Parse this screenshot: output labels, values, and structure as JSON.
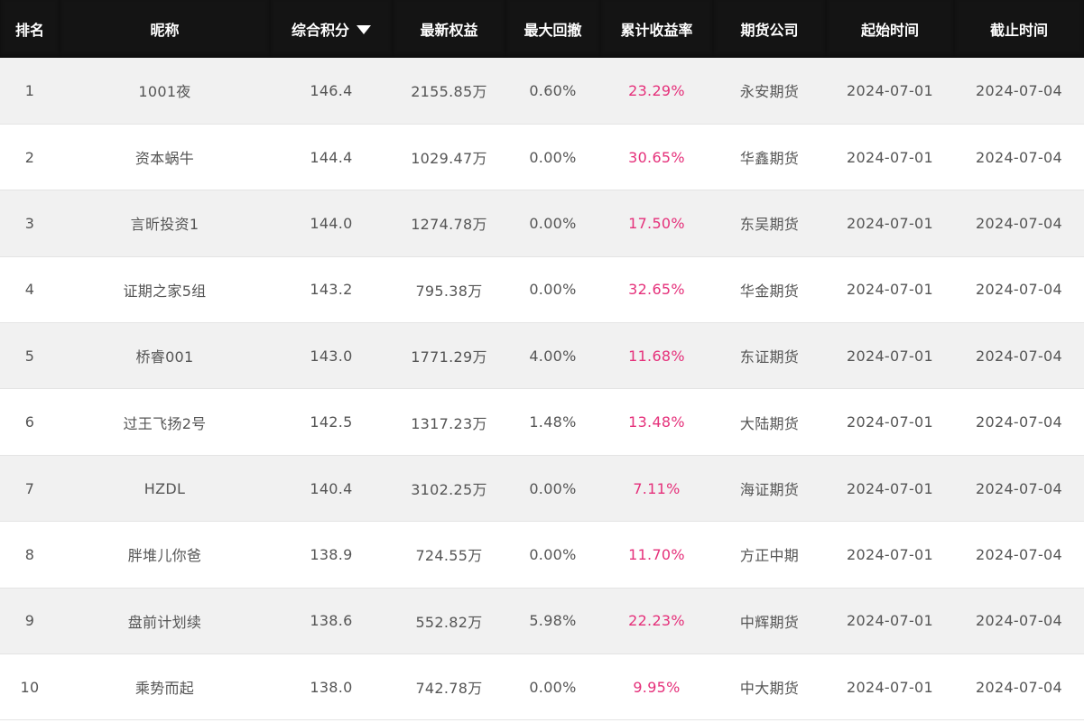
{
  "colors": {
    "header_bg": "#141414",
    "return_color": "#e5307a",
    "row_alt": "#f1f1f1"
  },
  "header": {
    "rank": "排名",
    "nickname": "昵称",
    "score": "综合积分",
    "equity": "最新权益",
    "drawdown": "最大回撤",
    "return": "累计收益率",
    "broker": "期货公司",
    "start": "起始时间",
    "end": "截止时间",
    "sort_icon": "triangle-down-icon"
  },
  "rows": [
    {
      "rank": "1",
      "nickname": "1001夜",
      "score": "146.4",
      "equity": "2155.85万",
      "drawdown": "0.60%",
      "return": "23.29%",
      "broker": "永安期货",
      "start": "2024-07-01",
      "end": "2024-07-04"
    },
    {
      "rank": "2",
      "nickname": "资本蜗牛",
      "score": "144.4",
      "equity": "1029.47万",
      "drawdown": "0.00%",
      "return": "30.65%",
      "broker": "华鑫期货",
      "start": "2024-07-01",
      "end": "2024-07-04"
    },
    {
      "rank": "3",
      "nickname": "言昕投资1",
      "score": "144.0",
      "equity": "1274.78万",
      "drawdown": "0.00%",
      "return": "17.50%",
      "broker": "东吴期货",
      "start": "2024-07-01",
      "end": "2024-07-04"
    },
    {
      "rank": "4",
      "nickname": "证期之家5组",
      "score": "143.2",
      "equity": "795.38万",
      "drawdown": "0.00%",
      "return": "32.65%",
      "broker": "华金期货",
      "start": "2024-07-01",
      "end": "2024-07-04"
    },
    {
      "rank": "5",
      "nickname": "桥睿001",
      "score": "143.0",
      "equity": "1771.29万",
      "drawdown": "4.00%",
      "return": "11.68%",
      "broker": "东证期货",
      "start": "2024-07-01",
      "end": "2024-07-04"
    },
    {
      "rank": "6",
      "nickname": "过王飞扬2号",
      "score": "142.5",
      "equity": "1317.23万",
      "drawdown": "1.48%",
      "return": "13.48%",
      "broker": "大陆期货",
      "start": "2024-07-01",
      "end": "2024-07-04"
    },
    {
      "rank": "7",
      "nickname": "HZDL",
      "score": "140.4",
      "equity": "3102.25万",
      "drawdown": "0.00%",
      "return": "7.11%",
      "broker": "海证期货",
      "start": "2024-07-01",
      "end": "2024-07-04"
    },
    {
      "rank": "8",
      "nickname": "胖堆儿你爸",
      "score": "138.9",
      "equity": "724.55万",
      "drawdown": "0.00%",
      "return": "11.70%",
      "broker": "方正中期",
      "start": "2024-07-01",
      "end": "2024-07-04"
    },
    {
      "rank": "9",
      "nickname": "盘前计划续",
      "score": "138.6",
      "equity": "552.82万",
      "drawdown": "5.98%",
      "return": "22.23%",
      "broker": "中辉期货",
      "start": "2024-07-01",
      "end": "2024-07-04"
    },
    {
      "rank": "10",
      "nickname": "乘势而起",
      "score": "138.0",
      "equity": "742.78万",
      "drawdown": "0.00%",
      "return": "9.95%",
      "broker": "中大期货",
      "start": "2024-07-01",
      "end": "2024-07-04"
    }
  ]
}
